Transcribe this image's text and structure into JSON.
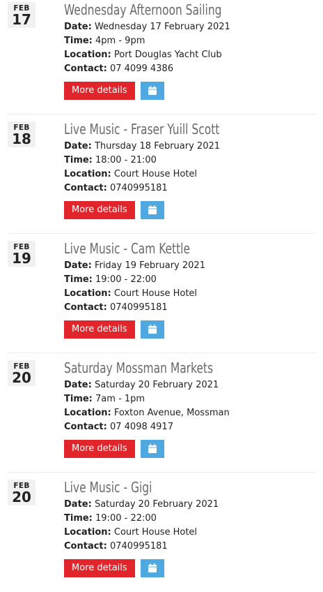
{
  "labels": {
    "date": "Date:",
    "time": "Time:",
    "location": "Location:",
    "contact": "Contact:"
  },
  "more_details_label": "More details",
  "icons": {
    "calendar": "calendar-icon"
  },
  "colors": {
    "more_button": "#e2242b",
    "calendar_button": "#4fa8e0",
    "title": "#6a6a6a"
  },
  "events": [
    {
      "month": "FEB",
      "day": "17",
      "title": "Wednesday Afternoon Sailing",
      "date": "Wednesday 17 February 2021",
      "time": "4pm - 9pm",
      "location": "Port Douglas Yacht Club",
      "contact": "07 4099 4386"
    },
    {
      "month": "FEB",
      "day": "18",
      "title": "Live Music - Fraser Yuill Scott",
      "date": "Thursday 18 February 2021",
      "time": "18:00 - 21:00",
      "location": "Court House Hotel",
      "contact": "0740995181"
    },
    {
      "month": "FEB",
      "day": "19",
      "title": "Live Music - Cam Kettle",
      "date": "Friday 19 February 2021",
      "time": "19:00 - 22:00",
      "location": "Court House Hotel",
      "contact": "0740995181"
    },
    {
      "month": "FEB",
      "day": "20",
      "title": "Saturday Mossman Markets",
      "date": "Saturday 20 February 2021",
      "time": "7am - 1pm",
      "location": "Foxton Avenue, Mossman",
      "contact": "07 4098 4917"
    },
    {
      "month": "FEB",
      "day": "20",
      "title": "Live Music - Gigi",
      "date": "Saturday 20 February 2021",
      "time": "19:00 - 22:00",
      "location": "Court House Hotel",
      "contact": "0740995181"
    }
  ]
}
